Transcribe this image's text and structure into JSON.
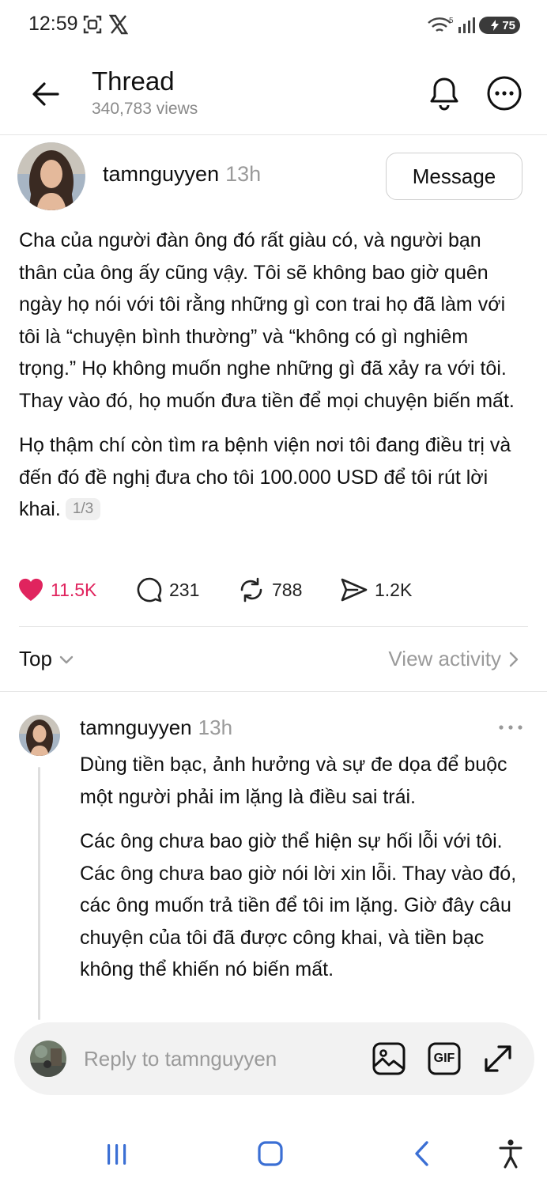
{
  "status_bar": {
    "time": "12:59",
    "battery": "75",
    "icons": [
      "screenshot-icon",
      "x-logo-icon",
      "wifi-icon",
      "signal-icon",
      "battery-icon"
    ]
  },
  "header": {
    "title": "Thread",
    "views": "340,783 views",
    "icons": [
      "back-arrow-icon",
      "bell-icon",
      "more-circle-icon"
    ]
  },
  "post": {
    "username": "tamnguyyen",
    "time": "13h",
    "message_label": "Message",
    "paragraphs": [
      "Cha của người đàn ông đó rất giàu có, và người bạn thân của ông ấy cũng vậy. Tôi sẽ không bao giờ quên ngày họ nói với tôi rằng những gì con trai họ đã làm với tôi là “chuyện bình thường” và “không có gì nghiêm trọng.” Họ không muốn nghe những gì đã xảy ra với tôi. Thay vào đó, họ muốn đưa tiền để mọi chuyện biến mất.",
      "Họ thậm chí còn tìm ra bệnh viện nơi tôi đang điều trị và đến đó đề nghị đưa cho tôi 100.000 USD để tôi rút lời khai."
    ],
    "page_indicator": "1/3",
    "stats": {
      "likes": "11.5K",
      "replies": "231",
      "reposts": "788",
      "shares": "1.2K"
    },
    "like_color": "#e0245e"
  },
  "sort": {
    "label": "Top",
    "view_activity": "View activity"
  },
  "reply": {
    "username": "tamnguyyen",
    "time": "13h",
    "paragraphs": [
      "Dùng tiền bạc, ảnh hưởng và sự đe dọa để buộc một người phải im lặng là điều sai trái.",
      "Các ông chưa bao giờ thể hiện sự hối lỗi với tôi. Các ông chưa bao giờ nói lời xin lỗi. Thay vào đó, các ông muốn trả tiền để tôi im lặng. Giờ đây câu chuyện của tôi đã được công khai, và tiền bạc không thể khiến nó biến mất."
    ]
  },
  "reply_bar": {
    "placeholder": "Reply to tamnguyyen",
    "gif_label": "GIF"
  },
  "nav": {
    "icons": [
      "recent-apps-icon",
      "home-icon",
      "back-icon",
      "accessibility-icon"
    ]
  }
}
